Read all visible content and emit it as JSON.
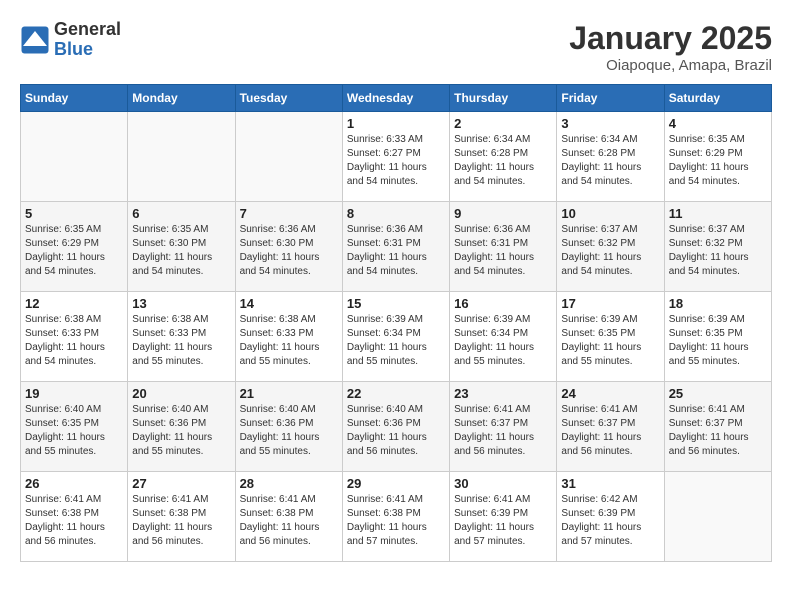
{
  "header": {
    "logo_general": "General",
    "logo_blue": "Blue",
    "title": "January 2025",
    "subtitle": "Oiapoque, Amapa, Brazil"
  },
  "weekdays": [
    "Sunday",
    "Monday",
    "Tuesday",
    "Wednesday",
    "Thursday",
    "Friday",
    "Saturday"
  ],
  "weeks": [
    [
      {
        "day": "",
        "info": ""
      },
      {
        "day": "",
        "info": ""
      },
      {
        "day": "",
        "info": ""
      },
      {
        "day": "1",
        "info": "Sunrise: 6:33 AM\nSunset: 6:27 PM\nDaylight: 11 hours and 54 minutes."
      },
      {
        "day": "2",
        "info": "Sunrise: 6:34 AM\nSunset: 6:28 PM\nDaylight: 11 hours and 54 minutes."
      },
      {
        "day": "3",
        "info": "Sunrise: 6:34 AM\nSunset: 6:28 PM\nDaylight: 11 hours and 54 minutes."
      },
      {
        "day": "4",
        "info": "Sunrise: 6:35 AM\nSunset: 6:29 PM\nDaylight: 11 hours and 54 minutes."
      }
    ],
    [
      {
        "day": "5",
        "info": "Sunrise: 6:35 AM\nSunset: 6:29 PM\nDaylight: 11 hours and 54 minutes."
      },
      {
        "day": "6",
        "info": "Sunrise: 6:35 AM\nSunset: 6:30 PM\nDaylight: 11 hours and 54 minutes."
      },
      {
        "day": "7",
        "info": "Sunrise: 6:36 AM\nSunset: 6:30 PM\nDaylight: 11 hours and 54 minutes."
      },
      {
        "day": "8",
        "info": "Sunrise: 6:36 AM\nSunset: 6:31 PM\nDaylight: 11 hours and 54 minutes."
      },
      {
        "day": "9",
        "info": "Sunrise: 6:36 AM\nSunset: 6:31 PM\nDaylight: 11 hours and 54 minutes."
      },
      {
        "day": "10",
        "info": "Sunrise: 6:37 AM\nSunset: 6:32 PM\nDaylight: 11 hours and 54 minutes."
      },
      {
        "day": "11",
        "info": "Sunrise: 6:37 AM\nSunset: 6:32 PM\nDaylight: 11 hours and 54 minutes."
      }
    ],
    [
      {
        "day": "12",
        "info": "Sunrise: 6:38 AM\nSunset: 6:33 PM\nDaylight: 11 hours and 54 minutes."
      },
      {
        "day": "13",
        "info": "Sunrise: 6:38 AM\nSunset: 6:33 PM\nDaylight: 11 hours and 55 minutes."
      },
      {
        "day": "14",
        "info": "Sunrise: 6:38 AM\nSunset: 6:33 PM\nDaylight: 11 hours and 55 minutes."
      },
      {
        "day": "15",
        "info": "Sunrise: 6:39 AM\nSunset: 6:34 PM\nDaylight: 11 hours and 55 minutes."
      },
      {
        "day": "16",
        "info": "Sunrise: 6:39 AM\nSunset: 6:34 PM\nDaylight: 11 hours and 55 minutes."
      },
      {
        "day": "17",
        "info": "Sunrise: 6:39 AM\nSunset: 6:35 PM\nDaylight: 11 hours and 55 minutes."
      },
      {
        "day": "18",
        "info": "Sunrise: 6:39 AM\nSunset: 6:35 PM\nDaylight: 11 hours and 55 minutes."
      }
    ],
    [
      {
        "day": "19",
        "info": "Sunrise: 6:40 AM\nSunset: 6:35 PM\nDaylight: 11 hours and 55 minutes."
      },
      {
        "day": "20",
        "info": "Sunrise: 6:40 AM\nSunset: 6:36 PM\nDaylight: 11 hours and 55 minutes."
      },
      {
        "day": "21",
        "info": "Sunrise: 6:40 AM\nSunset: 6:36 PM\nDaylight: 11 hours and 55 minutes."
      },
      {
        "day": "22",
        "info": "Sunrise: 6:40 AM\nSunset: 6:36 PM\nDaylight: 11 hours and 56 minutes."
      },
      {
        "day": "23",
        "info": "Sunrise: 6:41 AM\nSunset: 6:37 PM\nDaylight: 11 hours and 56 minutes."
      },
      {
        "day": "24",
        "info": "Sunrise: 6:41 AM\nSunset: 6:37 PM\nDaylight: 11 hours and 56 minutes."
      },
      {
        "day": "25",
        "info": "Sunrise: 6:41 AM\nSunset: 6:37 PM\nDaylight: 11 hours and 56 minutes."
      }
    ],
    [
      {
        "day": "26",
        "info": "Sunrise: 6:41 AM\nSunset: 6:38 PM\nDaylight: 11 hours and 56 minutes."
      },
      {
        "day": "27",
        "info": "Sunrise: 6:41 AM\nSunset: 6:38 PM\nDaylight: 11 hours and 56 minutes."
      },
      {
        "day": "28",
        "info": "Sunrise: 6:41 AM\nSunset: 6:38 PM\nDaylight: 11 hours and 56 minutes."
      },
      {
        "day": "29",
        "info": "Sunrise: 6:41 AM\nSunset: 6:38 PM\nDaylight: 11 hours and 57 minutes."
      },
      {
        "day": "30",
        "info": "Sunrise: 6:41 AM\nSunset: 6:39 PM\nDaylight: 11 hours and 57 minutes."
      },
      {
        "day": "31",
        "info": "Sunrise: 6:42 AM\nSunset: 6:39 PM\nDaylight: 11 hours and 57 minutes."
      },
      {
        "day": "",
        "info": ""
      }
    ]
  ]
}
